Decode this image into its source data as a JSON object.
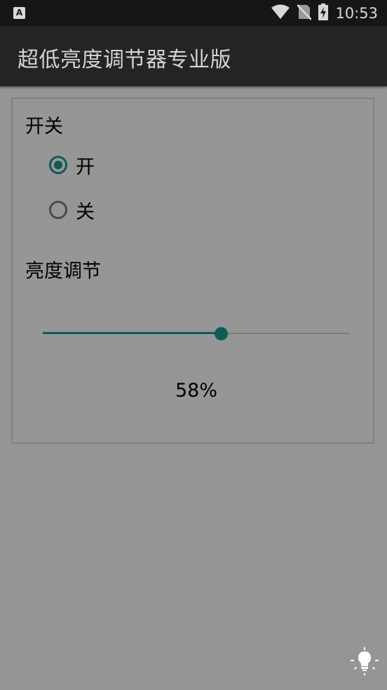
{
  "status_bar": {
    "app_icon_letter": "A",
    "time": "10:53",
    "icons": [
      "wifi-icon",
      "no-sim-icon",
      "battery-charging-icon"
    ]
  },
  "toolbar": {
    "title": "超低亮度调节器专业版"
  },
  "card": {
    "switch_label": "开关",
    "radio_options": [
      {
        "label": "开",
        "checked": true
      },
      {
        "label": "关",
        "checked": false
      }
    ],
    "brightness_label": "亮度调节",
    "brightness_value": 0.58,
    "brightness_text": "58%"
  },
  "fab": {
    "icon": "light-bulb-icon"
  },
  "colors": {
    "accent": "#0c5c55",
    "background": "#959595",
    "toolbar": "#242424",
    "status_bar": "#161616"
  }
}
